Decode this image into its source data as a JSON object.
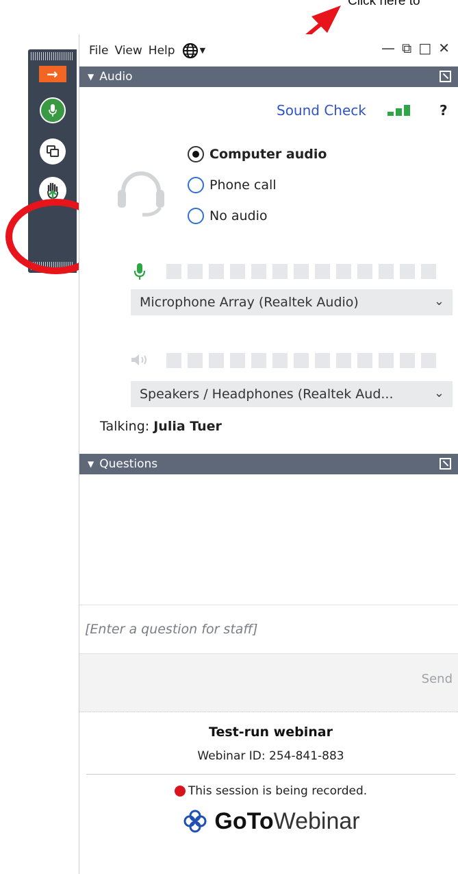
{
  "annotation": {
    "text": "Click here to"
  },
  "menu": {
    "file": "File",
    "view": "View",
    "help": "Help"
  },
  "audio": {
    "header": "Audio",
    "sound_check": "Sound Check",
    "help": "?",
    "options": [
      {
        "label": "Computer audio",
        "selected": true
      },
      {
        "label": "Phone call",
        "selected": false
      },
      {
        "label": "No audio",
        "selected": false
      }
    ],
    "microphone": "Microphone Array (Realtek Audio)",
    "speakers": "Speakers / Headphones (Realtek Aud...",
    "talking_label": "Talking:",
    "talking_name": "Julia Tuer"
  },
  "questions": {
    "header": "Questions",
    "placeholder": "[Enter a question for staff]",
    "send": "Send"
  },
  "footer": {
    "title": "Test-run webinar",
    "webinar_id": "Webinar ID: 254-841-883",
    "recording": "This session is being recorded.",
    "brand_bold": "GoTo",
    "brand_light": "Webinar"
  },
  "colors": {
    "accent_orange": "#f26522",
    "green": "#3a9a44",
    "highlight_red": "#e8141c",
    "header_gray": "#5f6878",
    "link_blue": "#2f53c8"
  }
}
